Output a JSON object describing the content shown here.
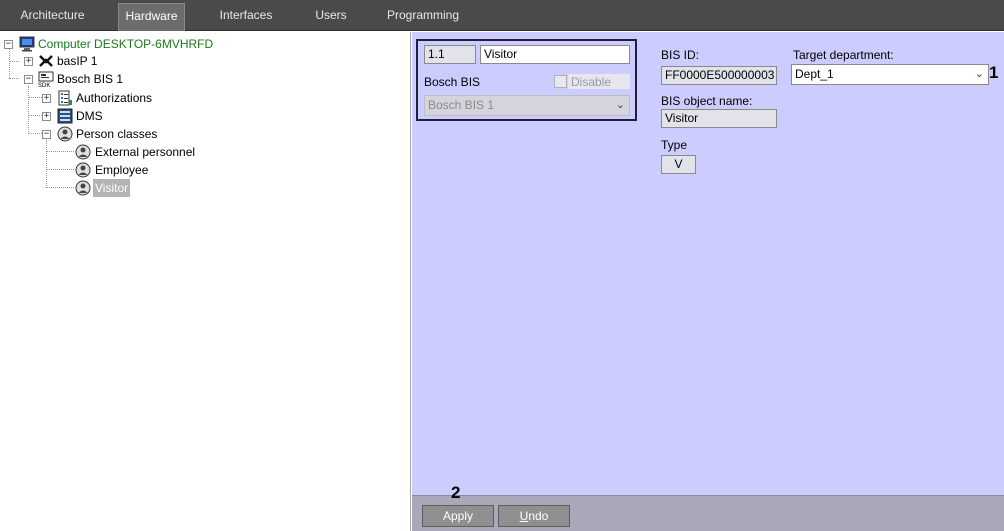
{
  "tabs": [
    {
      "label": "Architecture",
      "active": false
    },
    {
      "label": "Hardware",
      "active": true
    },
    {
      "label": "Interfaces",
      "active": false
    },
    {
      "label": "Users",
      "active": false
    },
    {
      "label": "Programming",
      "active": false
    }
  ],
  "tree": {
    "computer": "Computer DESKTOP-6MVHRFD",
    "basip": "basIP 1",
    "bosch": "Bosch BIS 1",
    "authorizations": "Authorizations",
    "dms": "DMS",
    "person_classes": "Person classes",
    "external": "External personnel",
    "employee": "Employee",
    "visitor": "Visitor"
  },
  "object": {
    "id": "1.1",
    "name": "Visitor",
    "type_label": "Bosch BIS",
    "disable_label": "Disable",
    "parent": "Bosch BIS 1"
  },
  "fields": {
    "bis_id_label": "BIS ID:",
    "bis_id_value": "FF0000E500000003",
    "bis_object_name_label": "BIS object name:",
    "bis_object_name_value": "Visitor",
    "type_label": "Type",
    "type_value": "V",
    "target_department_label": "Target department:",
    "target_department_value": "Dept_1"
  },
  "buttons": {
    "apply": "Apply",
    "undo_u": "U",
    "undo_rest": "ndo"
  },
  "callouts": {
    "one": "1",
    "two": "2"
  }
}
